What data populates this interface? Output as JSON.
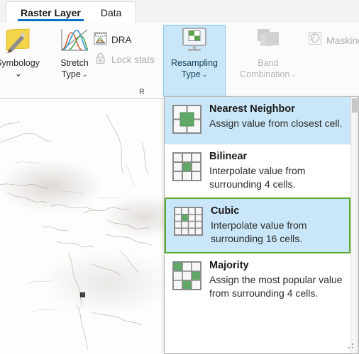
{
  "tabs": [
    {
      "label": "Raster Layer",
      "active": true
    },
    {
      "label": "Data",
      "active": false
    }
  ],
  "ribbon": {
    "group_label": "R",
    "symbology": {
      "label": "Symbology",
      "icon": "symbology-paint-icon",
      "chevron": "⌄"
    },
    "stretch": {
      "label_line1": "Stretch",
      "label_line2": "Type",
      "icon": "stretch-curves-icon",
      "chevron": "⌄"
    },
    "dra": {
      "label": "DRA",
      "icon": "dra-histogram-icon"
    },
    "lock_stats": {
      "label": "Lock stats",
      "icon": "lock-icon"
    },
    "resampling": {
      "label_line1": "Resampling",
      "label_line2": "Type",
      "icon": "monitor-grid-icon",
      "chevron": "⌄"
    },
    "band_combination": {
      "label_line1": "Band",
      "label_line2": "Combination",
      "icon": "layers-icon",
      "chevron": "⌄"
    },
    "masking": {
      "label": "Masking",
      "icon": "mask-polygon-icon"
    }
  },
  "dropdown": {
    "items": [
      {
        "title": "Nearest Neighbor",
        "desc": "Assign value from closest cell.",
        "icon": "grid-2x2-center-icon",
        "state": "highlight"
      },
      {
        "title": "Bilinear",
        "desc": "Interpolate value from surrounding 4 cells.",
        "icon": "grid-3x3-center-icon",
        "state": "normal"
      },
      {
        "title": "Cubic",
        "desc": "Interpolate value from surrounding 16 cells.",
        "icon": "grid-4x4-center-icon",
        "state": "selected"
      },
      {
        "title": "Majority",
        "desc": "Assign the most popular value from surrounding 4 cells.",
        "icon": "grid-3x3-majority-icon",
        "state": "normal"
      }
    ]
  },
  "colors": {
    "accent_blue": "#0a70c8",
    "highlight_fill": "#c9e7f8",
    "selected_border": "#5aa82b",
    "icon_green": "#5fa868",
    "disabled_text": "#b0b0b0"
  }
}
